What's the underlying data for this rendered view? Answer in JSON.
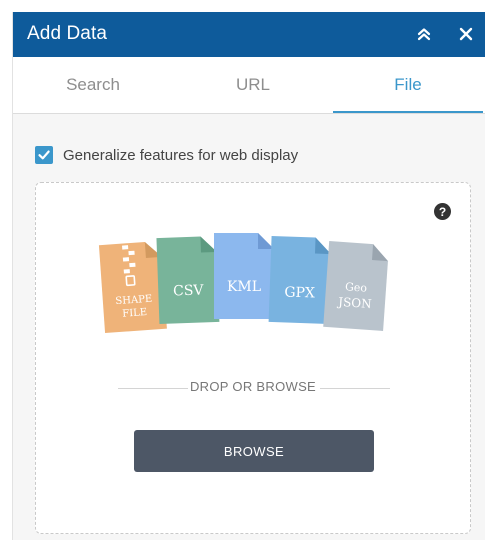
{
  "header": {
    "title": "Add Data",
    "collapse_icon": "double-chevron-up-icon",
    "close_icon": "close-icon"
  },
  "tabs": [
    {
      "label": "Search",
      "active": false
    },
    {
      "label": "URL",
      "active": false
    },
    {
      "label": "File",
      "active": true
    }
  ],
  "options": {
    "generalize_label": "Generalize features for web display",
    "generalize_checked": true
  },
  "dropzone": {
    "help_icon": "question-circle-icon",
    "file_types": [
      {
        "label_lines": [
          "SHAPE",
          "FILE"
        ],
        "color": "#efb379",
        "icon": "zip-file-icon"
      },
      {
        "label_lines": [
          "CSV"
        ],
        "color": "#78b49a",
        "icon": "file-icon"
      },
      {
        "label_lines": [
          "KML"
        ],
        "color": "#8cb8ee",
        "icon": "file-icon"
      },
      {
        "label_lines": [
          "GPX"
        ],
        "color": "#79b3e0",
        "icon": "file-icon"
      },
      {
        "label_lines": [
          "Geo",
          "JSON"
        ],
        "color": "#b9c3cc",
        "icon": "file-icon"
      }
    ],
    "drop_text": "DROP OR BROWSE",
    "browse_label": "BROWSE"
  },
  "colors": {
    "header_bg": "#0e5b9b",
    "accent": "#3b97cb",
    "browse_bg": "#4d5766"
  }
}
